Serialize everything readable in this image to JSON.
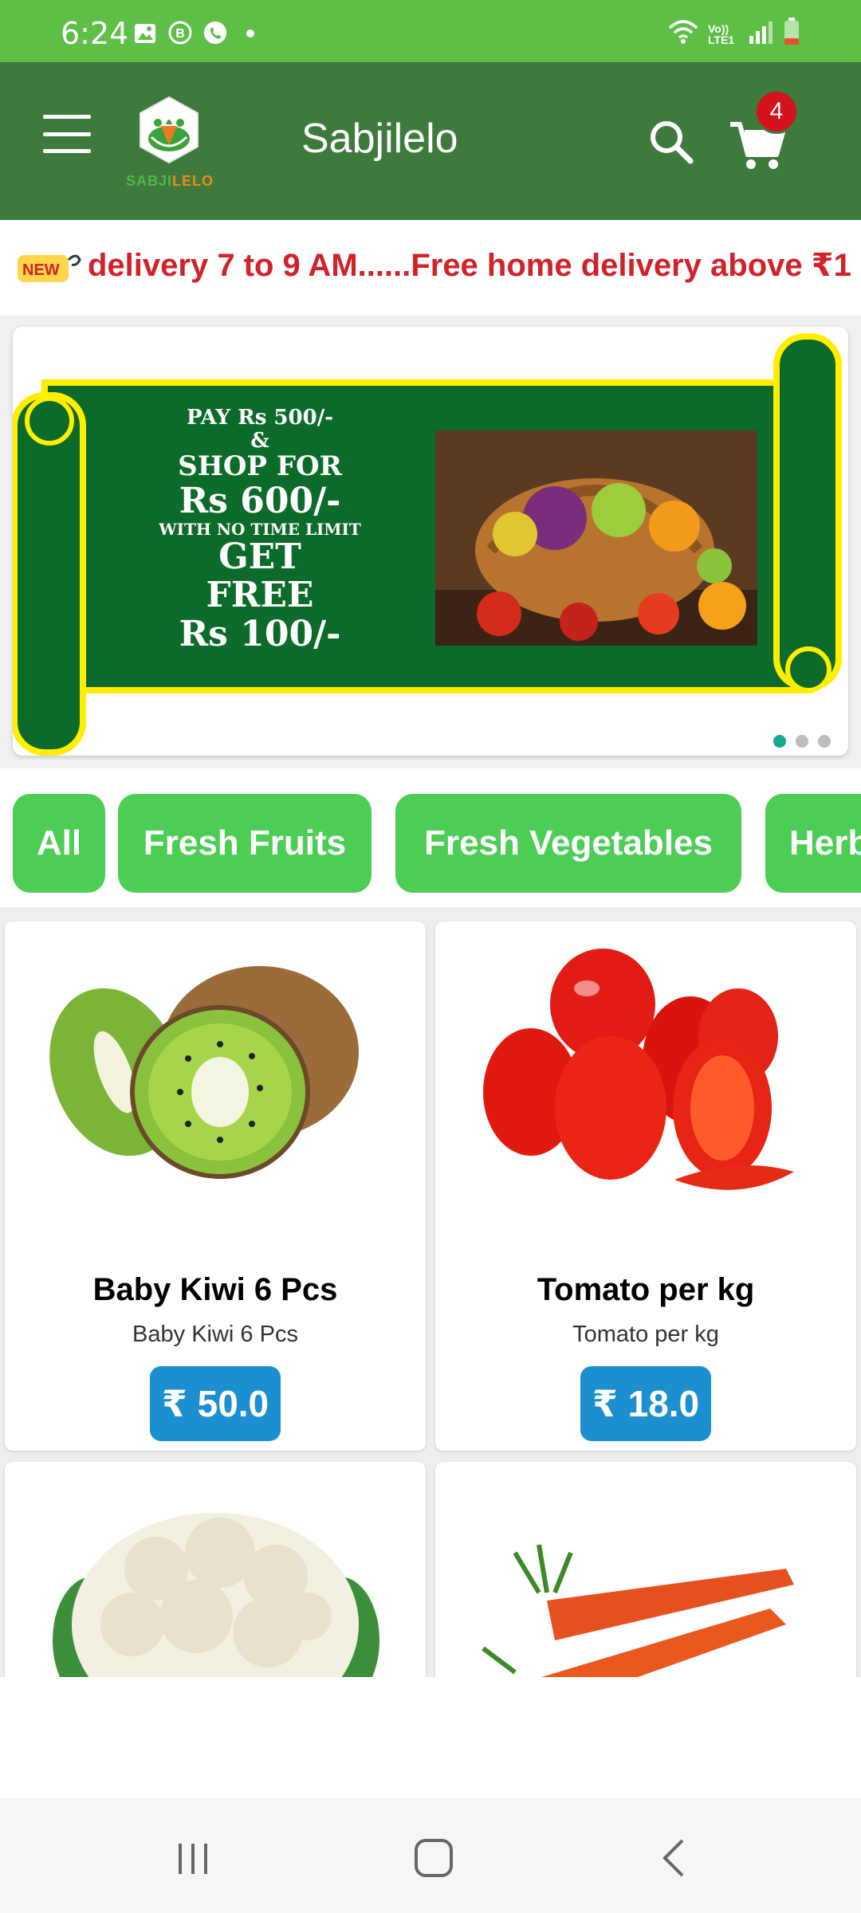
{
  "status_bar": {
    "time": "6:24",
    "left_icons": [
      "gallery-icon",
      "whatsapp-business-icon",
      "whatsapp-icon",
      "notification-dot-icon"
    ],
    "right_icons": [
      "wifi-icon",
      "volte-icon",
      "signal-icon",
      "battery-icon"
    ],
    "volte_label": "Vo)) LTE1"
  },
  "app_bar": {
    "title": "Sabjilelo",
    "logo_text_part1": "SABJI",
    "logo_text_part2": "LELO",
    "cart_count": "4",
    "background": "#3e7a3c"
  },
  "notice": {
    "badge": "NEW",
    "text": "delivery 7 to 9 AM......Free home delivery above ₹1"
  },
  "banner": {
    "line1": "PAY Rs 500/-",
    "line2": "&",
    "line3": "SHOP FOR",
    "line4": "Rs 600/-",
    "line5": "WITH NO TIME LIMIT",
    "line6": "GET",
    "line7": "FREE",
    "line8": "Rs 100/-",
    "active_slide": 1,
    "slide_count": 3
  },
  "categories": [
    {
      "label": "All"
    },
    {
      "label": "Fresh Fruits"
    },
    {
      "label": "Fresh Vegetables"
    },
    {
      "label": "Herbs"
    }
  ],
  "products": [
    {
      "title": "Baby Kiwi 6 Pcs",
      "subtitle": "Baby Kiwi 6 Pcs",
      "price": "₹ 50.0",
      "image": "kiwi"
    },
    {
      "title": "Tomato per kg",
      "subtitle": "Tomato per kg",
      "price": "₹ 18.0",
      "image": "tomato"
    },
    {
      "title": "",
      "subtitle": "",
      "price": "",
      "image": "cauliflower"
    },
    {
      "title": "",
      "subtitle": "",
      "price": "",
      "image": "carrot"
    }
  ],
  "colors": {
    "status_green": "#5dbf45",
    "chip_green": "#4ccd55",
    "price_blue": "#1b8fd0",
    "notice_red": "#d12229",
    "badge_red": "#d4121b"
  }
}
